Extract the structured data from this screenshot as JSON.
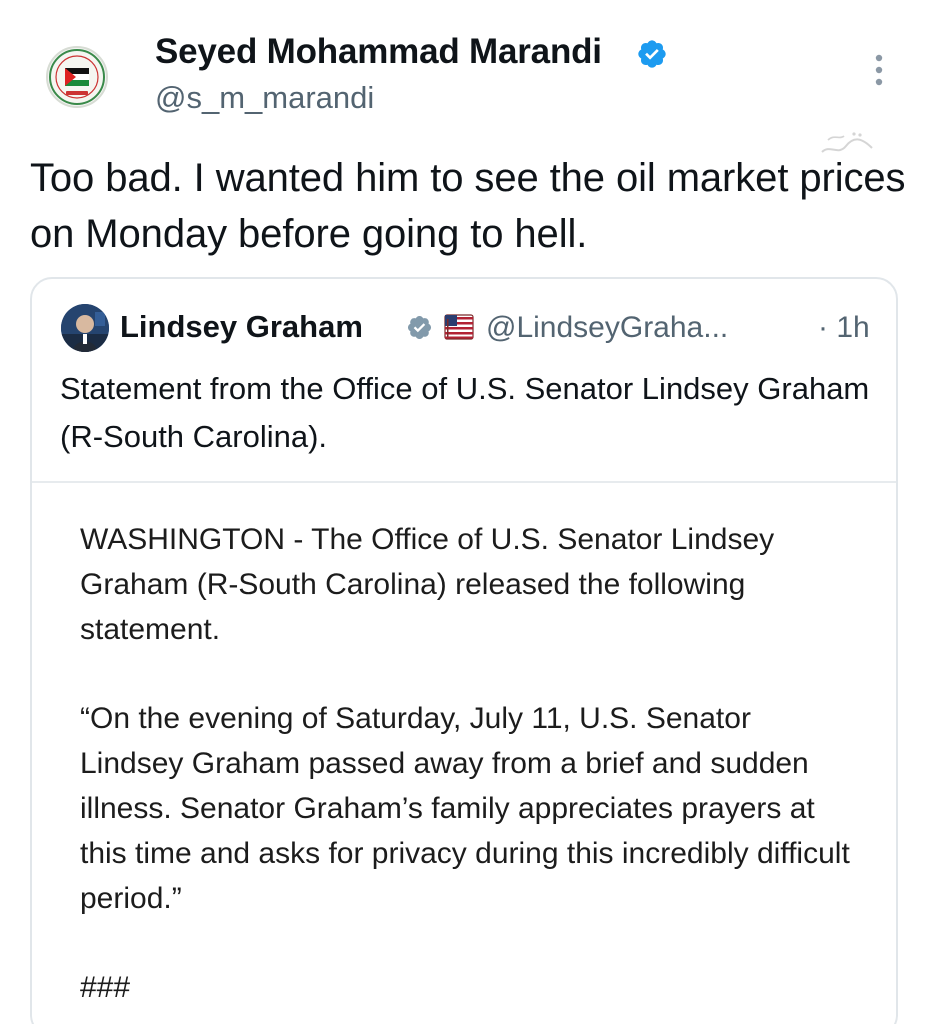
{
  "tweet": {
    "author_name": "Seyed Mohammad Marandi",
    "author_handle": "@s_m_marandi",
    "text": "Too bad. I wanted him to see the oil market prices on Monday before going to hell."
  },
  "quoted_tweet": {
    "author_name": "Lindsey Graham",
    "author_handle": "@LindseyGraha...",
    "time": "· 1h",
    "text": "Statement from the Office of U.S. Senator Lindsey Graham (R-South Carolina).",
    "statement": {
      "paragraph_1": "WASHINGTON - The Office of U.S. Senator Lindsey Graham (R-South Carolina) released the following statement.",
      "paragraph_2": "“On the evening of Saturday, July 11, U.S. Senator Lindsey Graham passed away from a brief and sudden illness. Senator Graham’s family appreciates prayers at this time and asks for privacy during this incredibly difficult period.”",
      "end_mark": "###"
    }
  },
  "colors": {
    "verified_blue": "#1d9bf0",
    "verified_gray": "#829aab",
    "secondary_text": "#536471",
    "border": "#e1e6ea"
  },
  "icons": {
    "verified_main": "verified-badge-icon",
    "verified_quote": "verified-badge-gray-icon",
    "more": "more-options-icon",
    "flag": "us-flag-icon"
  }
}
